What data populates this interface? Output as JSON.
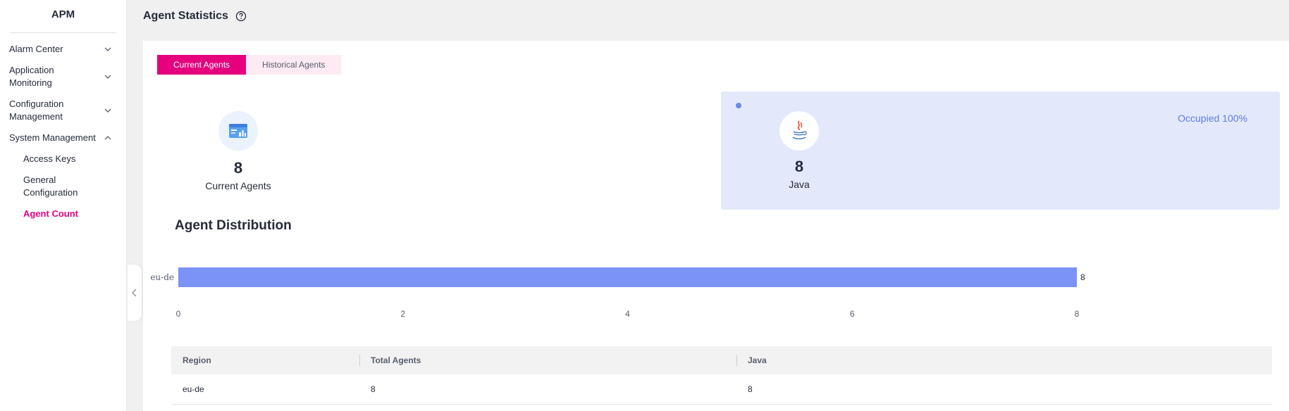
{
  "app": {
    "title": "APM"
  },
  "sidebar": {
    "items": [
      {
        "label": "Alarm Center",
        "expanded": false
      },
      {
        "label": "Application Monitoring",
        "expanded": false
      },
      {
        "label": "Configuration Management",
        "expanded": false
      },
      {
        "label": "System Management",
        "expanded": true
      }
    ],
    "sub_items": [
      {
        "label": "Access Keys",
        "active": false
      },
      {
        "label": "General Configuration",
        "active": false
      },
      {
        "label": "Agent Count",
        "active": true
      }
    ]
  },
  "header": {
    "title": "Agent Statistics",
    "help_icon": "question-circle-icon"
  },
  "tabs": [
    {
      "label": "Current Agents",
      "active": true
    },
    {
      "label": "Historical Agents",
      "active": false
    }
  ],
  "stats": {
    "current": {
      "value": "8",
      "label": "Current Agents",
      "icon": "agent-dashboard-icon"
    },
    "java": {
      "value": "8",
      "label": "Java",
      "icon": "java-icon",
      "occupied": "Occupied 100%"
    }
  },
  "distribution": {
    "title": "Agent Distribution"
  },
  "chart_data": {
    "type": "bar",
    "orientation": "horizontal",
    "categories": [
      "eu-de"
    ],
    "values": [
      8
    ],
    "data_labels": [
      "8"
    ],
    "xlim": [
      0,
      8
    ],
    "xticks": [
      "0",
      "2",
      "4",
      "6",
      "8"
    ],
    "bar_color": "#7b93f6",
    "grid": false
  },
  "table": {
    "columns": [
      "Region",
      "Total Agents",
      "Java"
    ],
    "rows": [
      [
        "eu-de",
        "8",
        "8"
      ]
    ]
  },
  "colors": {
    "accent": "#e6007e",
    "bar": "#7b93f6",
    "panel": "#e3e8fb"
  }
}
